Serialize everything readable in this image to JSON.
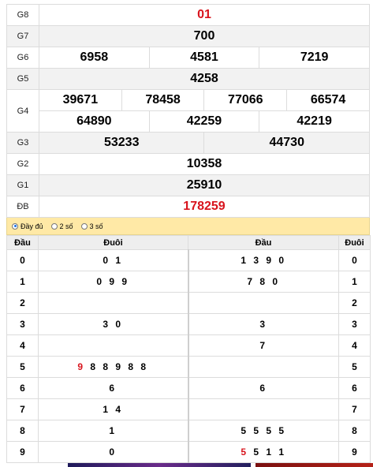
{
  "prizes": {
    "g8": {
      "label": "G8",
      "nums": [
        "01"
      ]
    },
    "g7": {
      "label": "G7",
      "nums": [
        "700"
      ]
    },
    "g6": {
      "label": "G6",
      "nums": [
        "6958",
        "4581",
        "7219"
      ]
    },
    "g5": {
      "label": "G5",
      "nums": [
        "4258"
      ]
    },
    "g4": {
      "label": "G4",
      "nums": [
        "39671",
        "78458",
        "77066",
        "66574",
        "64890",
        "42259",
        "42219"
      ]
    },
    "g3": {
      "label": "G3",
      "nums": [
        "53233",
        "44730"
      ]
    },
    "g2": {
      "label": "G2",
      "nums": [
        "10358"
      ]
    },
    "g1": {
      "label": "G1",
      "nums": [
        "25910"
      ]
    },
    "db": {
      "label": "ĐB",
      "nums": [
        "178259"
      ]
    }
  },
  "options": [
    "Đầy đủ",
    "2 số",
    "3 số"
  ],
  "loto": {
    "headers": [
      "Đầu",
      "Đuôi",
      "Đầu",
      "Đuôi"
    ],
    "rows": [
      {
        "d": "0",
        "duoi": "0 1",
        "dau": "1 3 9 0",
        "e": "0"
      },
      {
        "d": "1",
        "duoi": "0 9 9",
        "dau": "7 8 0",
        "e": "1"
      },
      {
        "d": "2",
        "duoi": "",
        "dau": "",
        "e": "2"
      },
      {
        "d": "3",
        "duoi": "3 0",
        "dau": "3",
        "e": "3"
      },
      {
        "d": "4",
        "duoi": "",
        "dau": "7",
        "e": "4"
      },
      {
        "d": "5",
        "duoi_red": "9",
        "duoi": " 8 8 9 8 8",
        "dau": "",
        "e": "5"
      },
      {
        "d": "6",
        "duoi": "6",
        "dau": "6",
        "e": "6"
      },
      {
        "d": "7",
        "duoi": "1 4",
        "dau": "",
        "e": "7"
      },
      {
        "d": "8",
        "duoi": "1",
        "dau": "5 5 5 5",
        "e": "8"
      },
      {
        "d": "9",
        "duoi": "0",
        "dau_red": "5",
        "dau": " 5 1 1",
        "e": "9"
      }
    ]
  }
}
